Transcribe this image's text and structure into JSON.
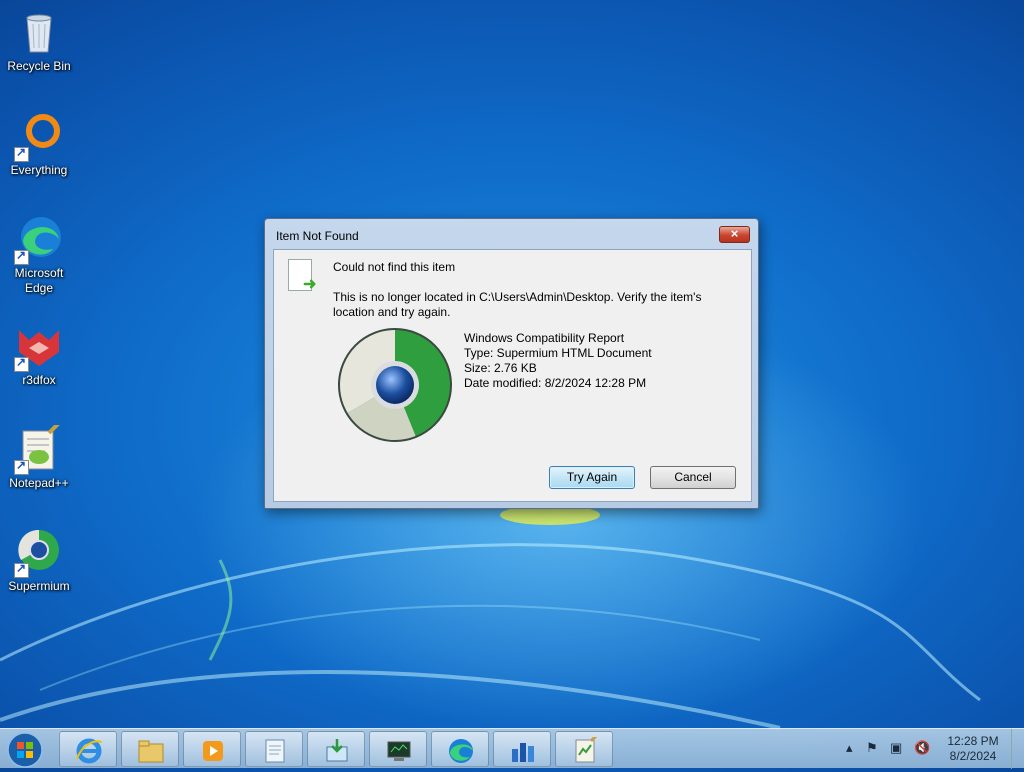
{
  "desktop": {
    "icons": [
      {
        "label": "Recycle Bin"
      },
      {
        "label": "Everything"
      },
      {
        "label": "Microsoft Edge"
      },
      {
        "label": "r3dfox"
      },
      {
        "label": "Notepad++"
      },
      {
        "label": "Supermium"
      }
    ]
  },
  "dialog": {
    "title": "Item Not Found",
    "close_label": "×",
    "heading": "Could not find this item",
    "message": "This is no longer located in C:\\Users\\Admin\\Desktop. Verify the item's location and try again.",
    "details": {
      "name": "Windows Compatibility Report",
      "type": "Type: Supermium HTML Document",
      "size": "Size: 2.76 KB",
      "modified": "Date modified: 8/2/2024 12:28 PM"
    },
    "buttons": {
      "try_again": "Try Again",
      "cancel": "Cancel"
    }
  },
  "taskbar": {
    "pinned": [
      "internet-explorer",
      "file-explorer",
      "media-player",
      "notepad",
      "program-installer",
      "device-manager",
      "microsoft-edge",
      "task-manager",
      "notepad-plus-plus"
    ],
    "tray_icons": [
      "show-hidden-icon",
      "flag-icon",
      "network-icon",
      "volume-muted-icon"
    ],
    "clock": {
      "time": "12:28 PM",
      "date": "8/2/2024"
    }
  }
}
